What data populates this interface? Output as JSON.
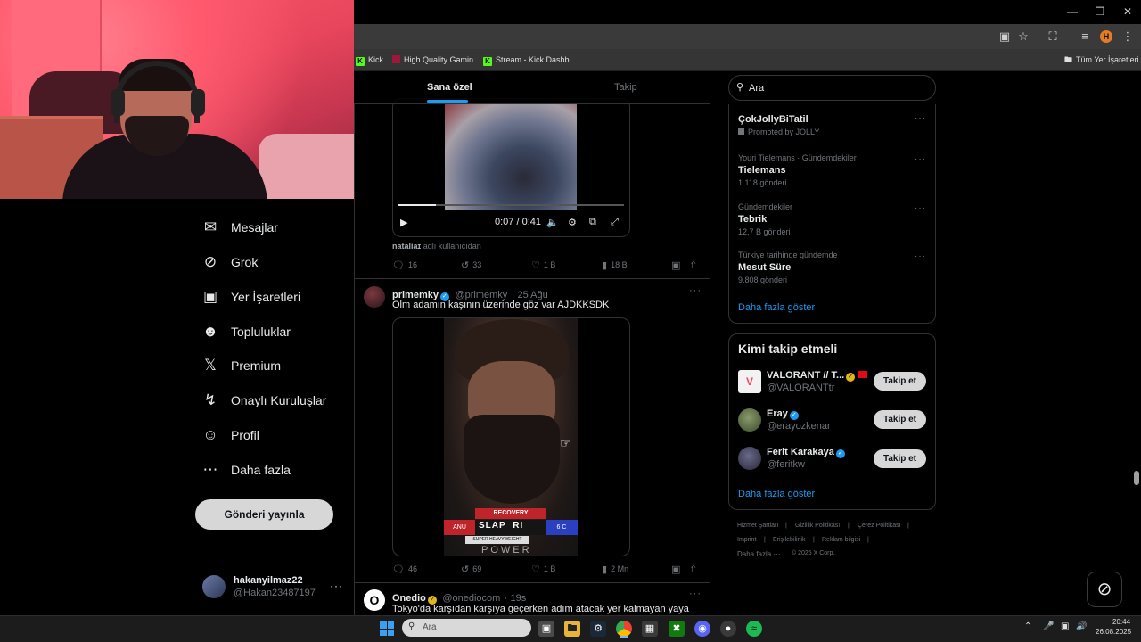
{
  "browser": {
    "bookmarks": [
      {
        "label": "Kick",
        "icon": "kick-icon"
      },
      {
        "label": "High Quality Gamin...",
        "icon": "bookmark-favicon-icon"
      },
      {
        "label": "Stream - Kick Dashb...",
        "icon": "kick-icon"
      }
    ],
    "all_bookmarks": "Tüm Yer İşaretleri",
    "profile_initial": "H"
  },
  "nav": {
    "items": [
      {
        "label": "Mesajlar",
        "icon": "envelope-icon"
      },
      {
        "label": "Grok",
        "icon": "grok-icon"
      },
      {
        "label": "Yer İşaretleri",
        "icon": "bookmark-icon"
      },
      {
        "label": "Topluluklar",
        "icon": "people-icon"
      },
      {
        "label": "Premium",
        "icon": "x-logo-icon"
      },
      {
        "label": "Onaylı Kuruluşlar",
        "icon": "lightning-icon"
      },
      {
        "label": "Profil",
        "icon": "person-icon"
      },
      {
        "label": "Daha fazla",
        "icon": "more-circle-icon"
      }
    ],
    "post_button": "Gönderi yayınla",
    "account": {
      "name": "hakanyilmaz22",
      "handle": "@Hakan23487197",
      "more": "···"
    }
  },
  "timeline": {
    "tabs": [
      "Sana özel",
      "Takip"
    ],
    "tweet1": {
      "video_time": "0:07 / 0:41",
      "video_progress": 0.17,
      "credit_user": "nataliaɪ",
      "credit_suffix": "adlı kullanıcıdan",
      "replies": "16",
      "reposts": "33",
      "likes": "1 B",
      "views": "18 B"
    },
    "tweet2": {
      "name": "primemky",
      "handle": "@primemky",
      "time": "· 25 Ağu",
      "text": "Olm adamın kaşının üzerinde göz var AJDKKSDK",
      "overlay_banner": "RECOVERY",
      "overlay_title": "SLAP",
      "overlay_right_label": "RI",
      "overlay_left": "ANU",
      "overlay_right": "6 C",
      "overlay_sub": "SUPER HEAVYWEIGHT MATCH",
      "overlay_power": "POWER",
      "replies": "46",
      "reposts": "69",
      "likes": "1 B",
      "views": "2 Mn"
    },
    "tweet3": {
      "name": "Onedio",
      "handle": "@onediocom",
      "time": "· 19s",
      "text": "Tokyo'da karşıdan karşıya geçerken adım atacak yer kalmayan yaya"
    }
  },
  "sidebar": {
    "search_placeholder": "Ara",
    "trends": [
      {
        "meta": "",
        "title": "ÇokJollyBiTatil",
        "sub": "Promoted by JOLLY"
      },
      {
        "meta": "Youri Tielemans · Gündemdekiler",
        "title": "Tielemans",
        "sub": "1.118 gönderi"
      },
      {
        "meta": "Gündemdekiler",
        "title": "Tebrik",
        "sub": "12,7 B gönderi"
      },
      {
        "meta": "Türkiye tarihinde gündemde",
        "title": "Mesut Süre",
        "sub": "9.808 gönderi"
      }
    ],
    "trends_more": "Daha fazla göster",
    "follow_title": "Kimi takip etmeli",
    "follow": [
      {
        "name": "VALORANT // T...",
        "handle": "@VALORANTtr",
        "button": "Takip et"
      },
      {
        "name": "Eray",
        "handle": "@erayozkenar",
        "button": "Takip et"
      },
      {
        "name": "Ferit Karakaya",
        "handle": "@feritkw",
        "button": "Takip et"
      }
    ],
    "follow_more": "Daha fazla göster",
    "footer": {
      "terms": "Hizmet Şartları",
      "privacy": "Gizlilik Politikası",
      "cookies": "Çerez Politikası",
      "imprint": "Imprint",
      "accessibility": "Erişilebilirlik",
      "ads": "Reklam bilgisi",
      "more": "Daha fazla ···",
      "copyright": "© 2025 X Corp."
    }
  },
  "taskbar": {
    "search_placeholder": "Ara",
    "time": "20:44",
    "date": "26.08.2025"
  },
  "colors": {
    "accent": "#1d9bf0",
    "kick": "#53fc18",
    "background": "#000000"
  }
}
